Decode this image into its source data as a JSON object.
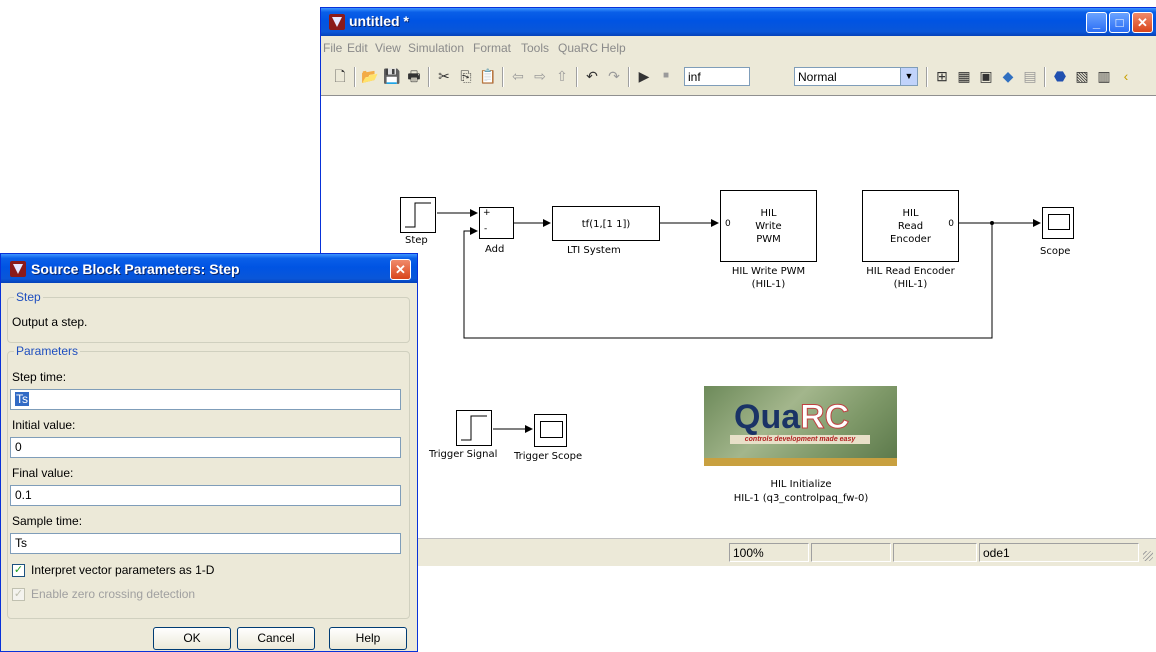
{
  "main_window": {
    "title": "untitled *",
    "menu": [
      "File",
      "Edit",
      "View",
      "Simulation",
      "Format",
      "Tools",
      "QuaRC",
      "Help"
    ],
    "toolbar": {
      "stop_time": "inf",
      "sim_mode": "Normal"
    },
    "status": {
      "zoom": "100%",
      "solver": "ode1"
    }
  },
  "diagram": {
    "step": {
      "label": "Step"
    },
    "add": {
      "label": "Add",
      "sign_plus": "+",
      "sign_minus": "-"
    },
    "lti": {
      "text": "tf(1,[1 1])",
      "label": "LTI System"
    },
    "hil_write": {
      "line1": "HIL",
      "line2": "Write",
      "line3": "PWM",
      "port": "0",
      "label1": "HIL Write PWM",
      "label2": "(HIL-1)"
    },
    "hil_read": {
      "line1": "HIL",
      "line2": "Read",
      "line3": "Encoder",
      "port": "0",
      "label1": "HIL Read Encoder",
      "label2": "(HIL-1)"
    },
    "scope": {
      "label": "Scope"
    },
    "trigger_signal": {
      "label": "Trigger Signal"
    },
    "trigger_scope": {
      "label": "Trigger Scope"
    },
    "hil_init": {
      "logo_main": "Qua",
      "logo_rc": "RC",
      "tagline": "controls development made easy",
      "label1": "HIL Initialize",
      "label2": "HIL-1 (q3_controlpaq_fw-0)"
    }
  },
  "dialog": {
    "title": "Source Block Parameters: Step",
    "group_step": "Step",
    "description": "Output a step.",
    "group_params": "Parameters",
    "fields": [
      {
        "label": "Step time:",
        "value": "Ts"
      },
      {
        "label": "Initial value:",
        "value": "0"
      },
      {
        "label": "Final value:",
        "value": "0.1"
      },
      {
        "label": "Sample time:",
        "value": "Ts"
      }
    ],
    "check_vector": {
      "label": "Interpret vector parameters as 1-D",
      "checked": true
    },
    "check_zero": {
      "label": "Enable zero crossing detection",
      "checked": true,
      "enabled": false
    },
    "buttons": {
      "ok": "OK",
      "cancel": "Cancel",
      "help": "Help"
    }
  }
}
